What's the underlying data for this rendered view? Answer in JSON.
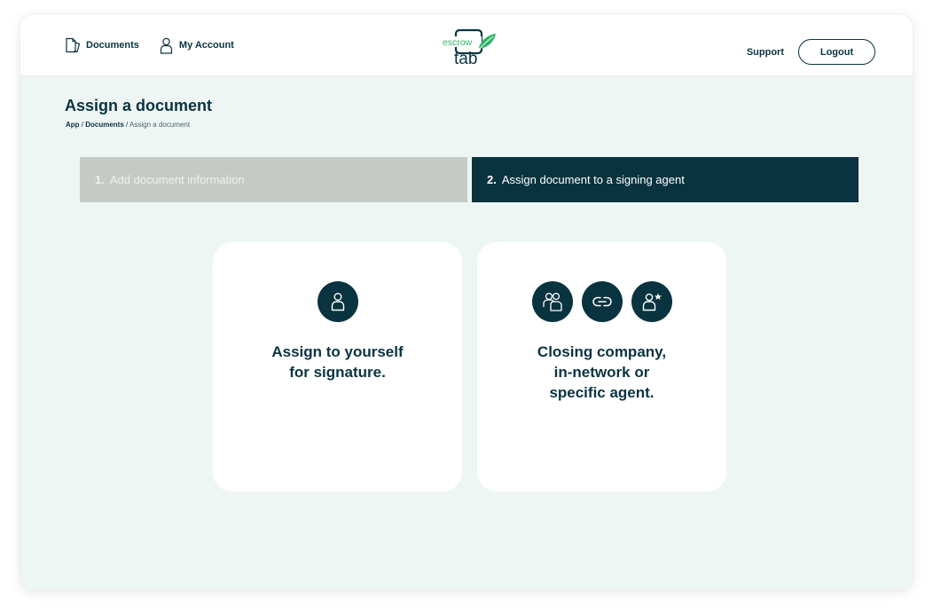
{
  "header": {
    "nav": {
      "documents_label": "Documents",
      "account_label": "My Account"
    },
    "logo": {
      "word_top": "escrow",
      "word_bottom": "tab"
    },
    "support_label": "Support",
    "logout_label": "Logout"
  },
  "page": {
    "title": "Assign a document",
    "breadcrumb": {
      "app": "App",
      "sep1": " / ",
      "documents": "Documents",
      "sep2": " / ",
      "current": "Assign a document"
    }
  },
  "steps": [
    {
      "number": "1.",
      "label": "Add document information",
      "state": "inactive"
    },
    {
      "number": "2.",
      "label": "Assign document to a signing agent",
      "state": "active"
    }
  ],
  "options": [
    {
      "text": "Assign to yourself\nfor signature.",
      "icons": [
        "user-icon"
      ]
    },
    {
      "text": "Closing company,\nin-network or\nspecific agent.",
      "icons": [
        "users-group-icon",
        "link-icon",
        "user-star-icon"
      ]
    }
  ],
  "colors": {
    "primary": "#0a3340",
    "accent_green": "#2fb36a",
    "background": "#eef6f4",
    "inactive_step": "#c5cac5"
  }
}
